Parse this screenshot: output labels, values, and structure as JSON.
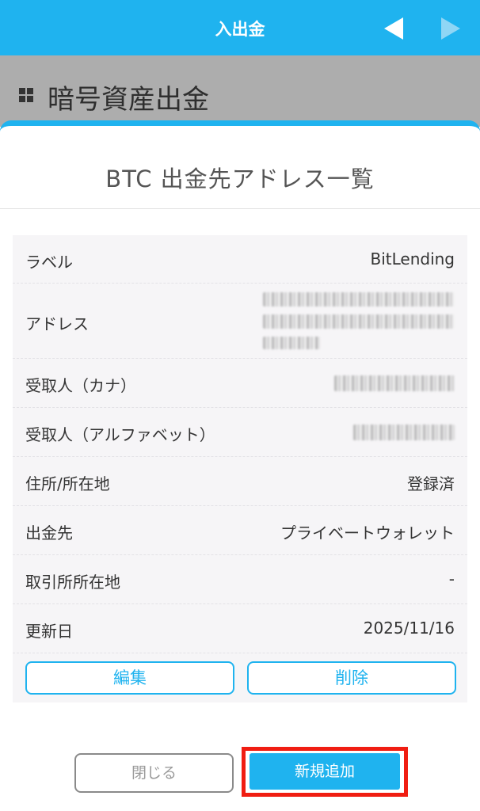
{
  "header": {
    "title": "入出金",
    "back_icon": "triangle-left-icon",
    "forward_icon": "triangle-right-icon"
  },
  "subheader": {
    "title": "暗号資産出金",
    "icon": "grid-icon"
  },
  "panel": {
    "title": "BTC 出金先アドレス一覧"
  },
  "details": {
    "label": {
      "key": "ラベル",
      "value": "BitLending"
    },
    "address": {
      "key": "アドレス"
    },
    "recipient_kana": {
      "key": "受取人（カナ）"
    },
    "recipient_alpha": {
      "key": "受取人（アルファベット）"
    },
    "address_location": {
      "key": "住所/所在地",
      "value": "登録済"
    },
    "destination": {
      "key": "出金先",
      "value": "プライベートウォレット"
    },
    "exchange_location": {
      "key": "取引所所在地",
      "value": "-"
    },
    "updated": {
      "key": "更新日",
      "value": "2025/11/16"
    }
  },
  "actions": {
    "edit": "編集",
    "delete": "削除",
    "close": "閉じる",
    "add_new": "新規追加"
  },
  "colors": {
    "accent": "#1fb3ef",
    "highlight": "#f01d12",
    "subbar": "#adadad"
  }
}
